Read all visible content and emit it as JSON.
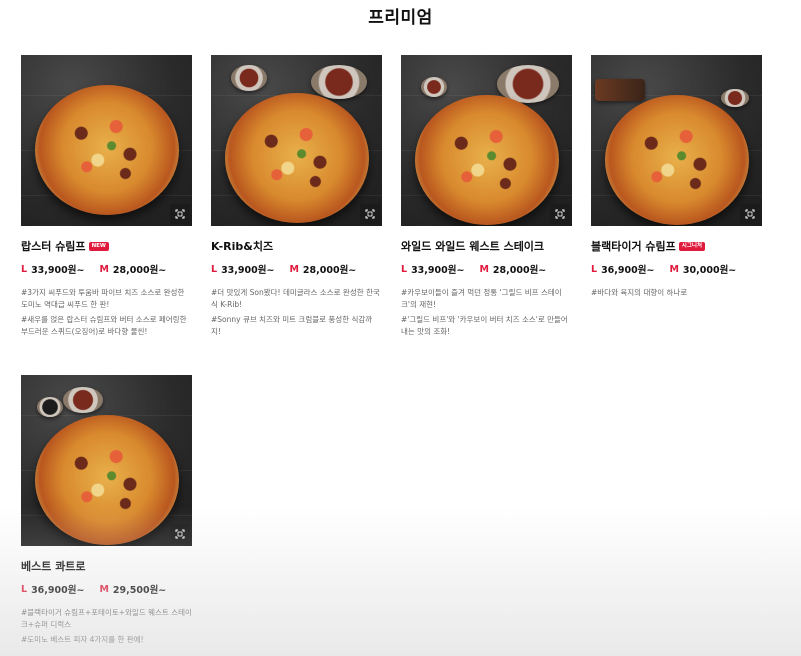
{
  "section_title": "프리미엄",
  "products": [
    {
      "name": "랍스터 슈림프",
      "badge": "NEW",
      "price_large": "33,900원~",
      "price_medium": "28,000원~",
      "descriptions": [
        "#3가지 씨푸드와 투움바 파이브 치즈 소스로 완성한 도미노 역대급 씨푸드 한 판!",
        "#새우를 얹은 랍스터 슈림프와 버터 소스로 페어링한 부드러운 스퀴드(오징어)로 바다향 물씬!"
      ]
    },
    {
      "name": "K-Rib&치즈",
      "badge": "",
      "price_large": "33,900원~",
      "price_medium": "28,000원~",
      "descriptions": [
        "#더 맛있게 Son봤다! 데미글라스 소스로 완성한 한국식 K-Rib!",
        "#Sonny 큐브 치즈와 미트 크럼블로 풍성한 식감까지!"
      ]
    },
    {
      "name": "와일드 와일드 웨스트 스테이크",
      "badge": "",
      "price_large": "33,900원~",
      "price_medium": "28,000원~",
      "descriptions": [
        "#카우보이들이 즐겨 먹던 정통 '그릴드 비프 스테이크'의 재현!",
        "#'그릴드 비프'와 '카우보이 버터 치즈 소스'로 만들어 내는 맛의 조화!"
      ]
    },
    {
      "name": "블랙타이거 슈림프",
      "badge": "시그니처",
      "price_large": "36,900원~",
      "price_medium": "30,000원~",
      "descriptions": [
        "#바다와 육지의 대향이 하나로"
      ]
    },
    {
      "name": "베스트 콰트로",
      "badge": "",
      "price_large": "36,900원~",
      "price_medium": "29,500원~",
      "descriptions": [
        "#블랙타이거 슈림프+포테이토+와일드 웨스트 스테이크+슈퍼 디럭스",
        "#도미노 베스트 피자 4가지를 한 판에!"
      ]
    }
  ],
  "labels": {
    "size_large": "L",
    "size_medium": "M"
  },
  "colors": {
    "accent": "#e01a3c",
    "thumb_bg": "#2b2b2b"
  },
  "icons": {
    "zoom": "zoom-icon"
  }
}
